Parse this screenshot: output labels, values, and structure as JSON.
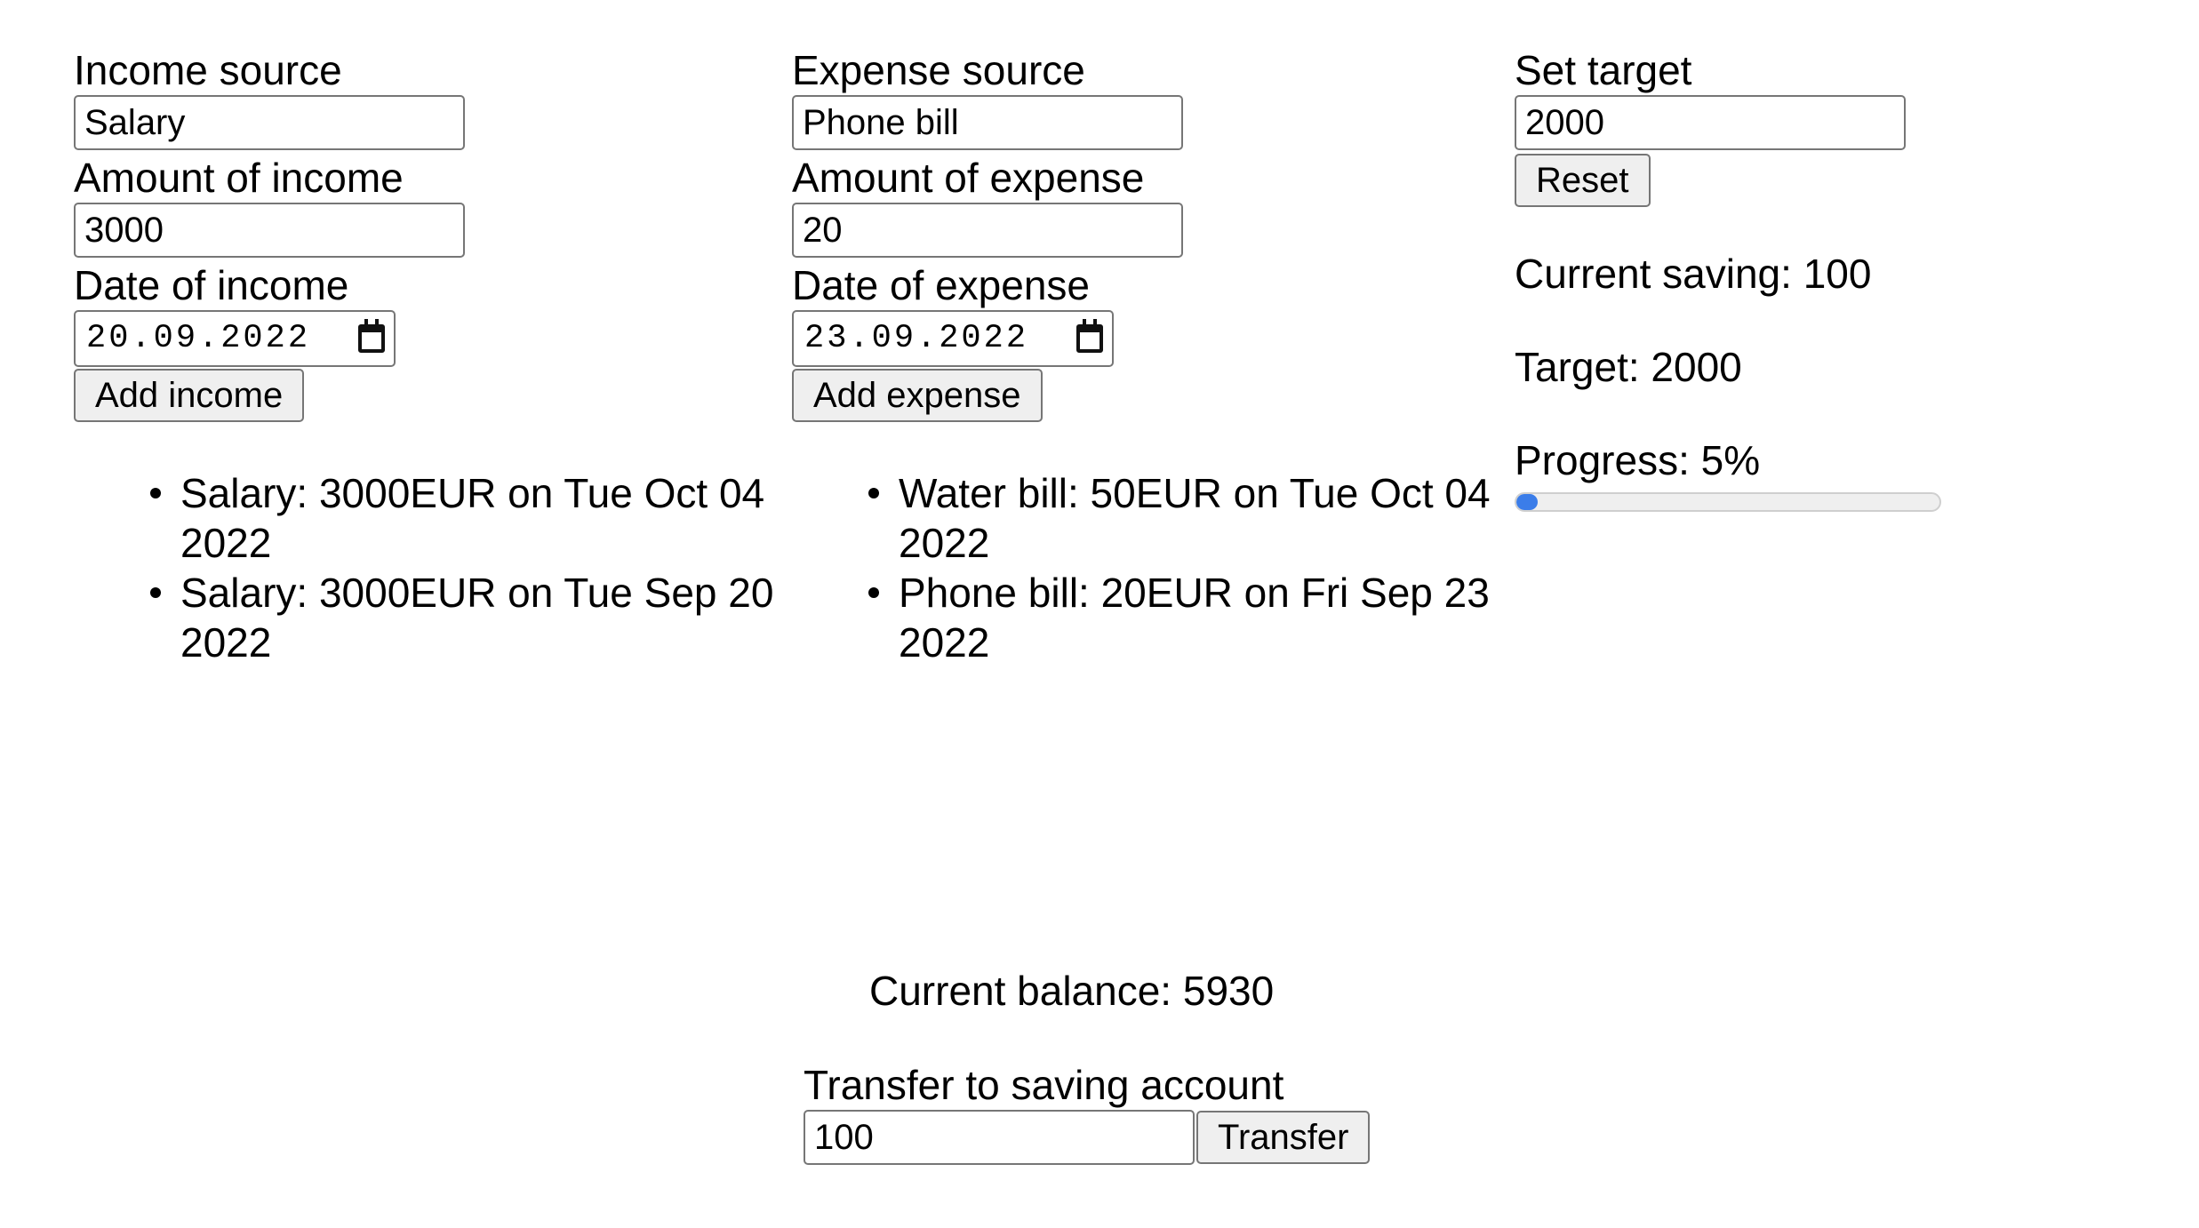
{
  "income": {
    "source_label": "Income source",
    "source_value": "Salary",
    "amount_label": "Amount of income",
    "amount_value": "3000",
    "date_label": "Date of income",
    "date_value": "20.09.2022",
    "add_button": "Add income",
    "entries": [
      "Salary: 3000EUR on Tue Oct 04 2022",
      "Salary: 3000EUR on Tue Sep 20 2022"
    ]
  },
  "expense": {
    "source_label": "Expense source",
    "source_value": "Phone bill",
    "amount_label": "Amount of expense",
    "amount_value": "20",
    "date_label": "Date of expense",
    "date_value": "23.09.2022",
    "add_button": "Add expense",
    "entries": [
      "Water bill: 50EUR on Tue Oct 04 2022",
      "Phone bill: 20EUR on Fri Sep 23 2022"
    ]
  },
  "target": {
    "label": "Set target",
    "value": "2000",
    "reset_button": "Reset",
    "current_saving_text": "Current saving: 100",
    "target_text": "Target: 2000",
    "progress_text": "Progress: 5%",
    "progress_fraction": 0.05,
    "progress_color": "#3b7de9"
  },
  "balance": {
    "text": "Current balance: 5930"
  },
  "transfer": {
    "label": "Transfer to saving account",
    "value": "100",
    "button": "Transfer"
  }
}
